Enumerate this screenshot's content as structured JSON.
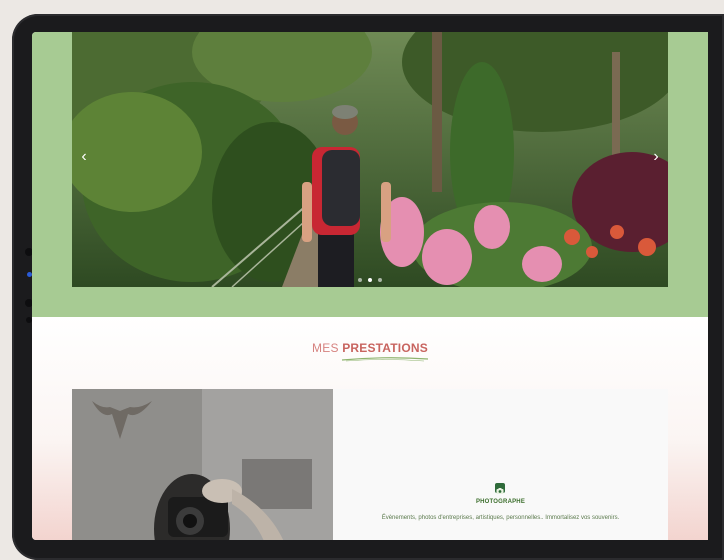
{
  "hero": {
    "prev_glyph": "‹",
    "next_glyph": "›",
    "slides_count_visible": 3,
    "active_slide": 1
  },
  "section": {
    "title_light": "MES ",
    "title_bold": "PRESTATIONS"
  },
  "service": {
    "icon": "camera-icon",
    "title": "PHOTOGRAPHE",
    "description": "Évènements, photos d'entreprises, artistiques, personnelles.. Immortalisez vos souvenirs."
  },
  "colors": {
    "hero_band": "#a7cb93",
    "title_pink": "#c8645f",
    "green_text": "#3b6e2c"
  }
}
